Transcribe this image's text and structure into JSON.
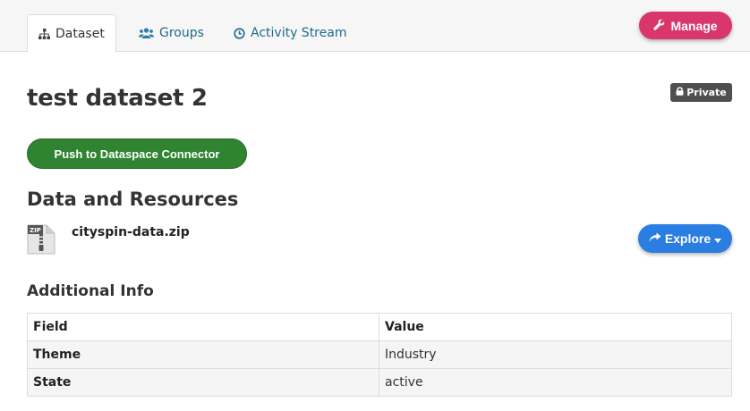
{
  "tabs": [
    {
      "label": "Dataset",
      "icon": "sitemap-icon",
      "active": true
    },
    {
      "label": "Groups",
      "icon": "users-icon",
      "active": false
    },
    {
      "label": "Activity Stream",
      "icon": "clock-icon",
      "active": false
    }
  ],
  "manage_label": "Manage",
  "dataset": {
    "title": "test dataset 2",
    "visibility": "Private"
  },
  "push_label": "Push to Dataspace Connector",
  "resources": {
    "heading": "Data and Resources",
    "items": [
      {
        "name": "cityspin-data.zip",
        "format": "ZIP",
        "action": "Explore"
      }
    ]
  },
  "additional_info": {
    "heading": "Additional Info",
    "columns": [
      "Field",
      "Value"
    ],
    "rows": [
      {
        "field": "Theme",
        "value": "Industry"
      },
      {
        "field": "State",
        "value": "active"
      }
    ]
  },
  "colors": {
    "manage": "#d9366b",
    "push": "#2f8331",
    "explore": "#2a7de1",
    "badge": "#4f4f4f",
    "tab_link": "#1f6b8a"
  }
}
